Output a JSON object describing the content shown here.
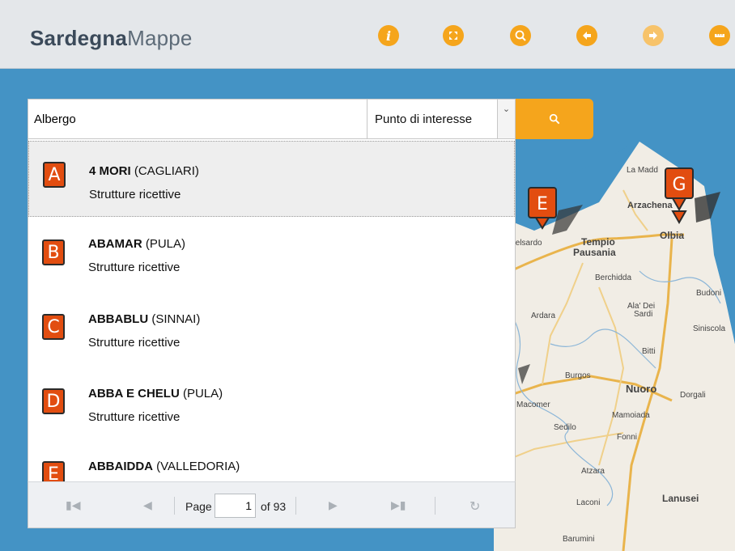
{
  "app": {
    "brand_bold": "Sardegna",
    "brand_light": "Mappe"
  },
  "header_buttons": [
    {
      "name": "info-icon",
      "color": "#f5a51c"
    },
    {
      "name": "fullscreen-icon",
      "color": "#f5a51c"
    },
    {
      "name": "zoom-area-icon",
      "color": "#f5a51c"
    },
    {
      "name": "back-arrow-icon",
      "color": "#f5a51c"
    },
    {
      "name": "forward-arrow-icon",
      "color": "#f7c36a"
    },
    {
      "name": "measure-icon",
      "color": "#f5a51c"
    }
  ],
  "search": {
    "value": "Albergo",
    "category": "Punto di interesse",
    "button_icon": "search-icon"
  },
  "results": [
    {
      "letter": "A",
      "name": "4 MORI",
      "place": "(CAGLIARI)",
      "category": "Strutture ricettive",
      "selected": true
    },
    {
      "letter": "B",
      "name": "ABAMAR",
      "place": "(PULA)",
      "category": "Strutture ricettive",
      "selected": false
    },
    {
      "letter": "C",
      "name": "ABBABLU",
      "place": "(SINNAI)",
      "category": "Strutture ricettive",
      "selected": false
    },
    {
      "letter": "D",
      "name": "ABBA E CHELU",
      "place": "(PULA)",
      "category": "Strutture ricettive",
      "selected": false
    },
    {
      "letter": "E",
      "name": "ABBAIDDA",
      "place": "(VALLEDORIA)",
      "category": "Strutture ricettive",
      "selected": false
    }
  ],
  "pager": {
    "page_label": "Page",
    "current_page": "1",
    "of_label": "of 93"
  },
  "map": {
    "markers": [
      "E",
      "G"
    ],
    "places": [
      "La Madd",
      "Arzachena",
      "Olbia",
      "Tempio",
      "Pausania",
      "telsardo",
      "Berchidda",
      "Budoni",
      "Ala' Dei",
      "Sardi",
      "Ardara",
      "Siniscola",
      "Bitti",
      "Burgos",
      "Nuoro",
      "Dorgali",
      "Macomer",
      "Mamoiada",
      "Sedilo",
      "Fonni",
      "Atzara",
      "no",
      "Laconi",
      "Lanusei",
      "Barumini"
    ]
  },
  "colors": {
    "accent": "#f5a51c",
    "marker": "#e24d10",
    "background": "#4493c5"
  }
}
